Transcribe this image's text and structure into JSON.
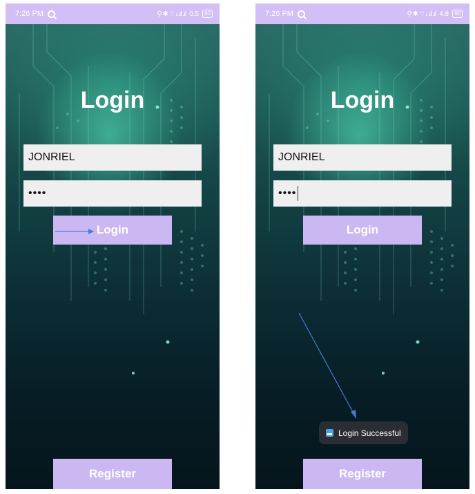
{
  "screens": [
    {
      "status": {
        "time": "7:26 PM",
        "signal_text": "⚲ ✱ ⌔ ᵢₗ .ıl .ıl",
        "net_text": "0.5",
        "battery": "60"
      },
      "title": "Login",
      "username": "JONRIEL",
      "password": "••••",
      "login_label": "Login",
      "register_label": "Register"
    },
    {
      "status": {
        "time": "7:26 PM",
        "signal_text": "⚲ ✱ ⌔ ᵢₗ .ıl .ıl",
        "net_text": "4.8",
        "battery": "60"
      },
      "title": "Login",
      "username": "JONRIEL",
      "password": "••••",
      "login_label": "Login",
      "register_label": "Register",
      "toast": "Login Successful"
    }
  ],
  "colors": {
    "status_bar": "#d2bff6",
    "button": "#cbb7f2",
    "field": "#efefef",
    "annotation_arrow": "#4a79d8",
    "toast_bg": "#2a2e34"
  }
}
